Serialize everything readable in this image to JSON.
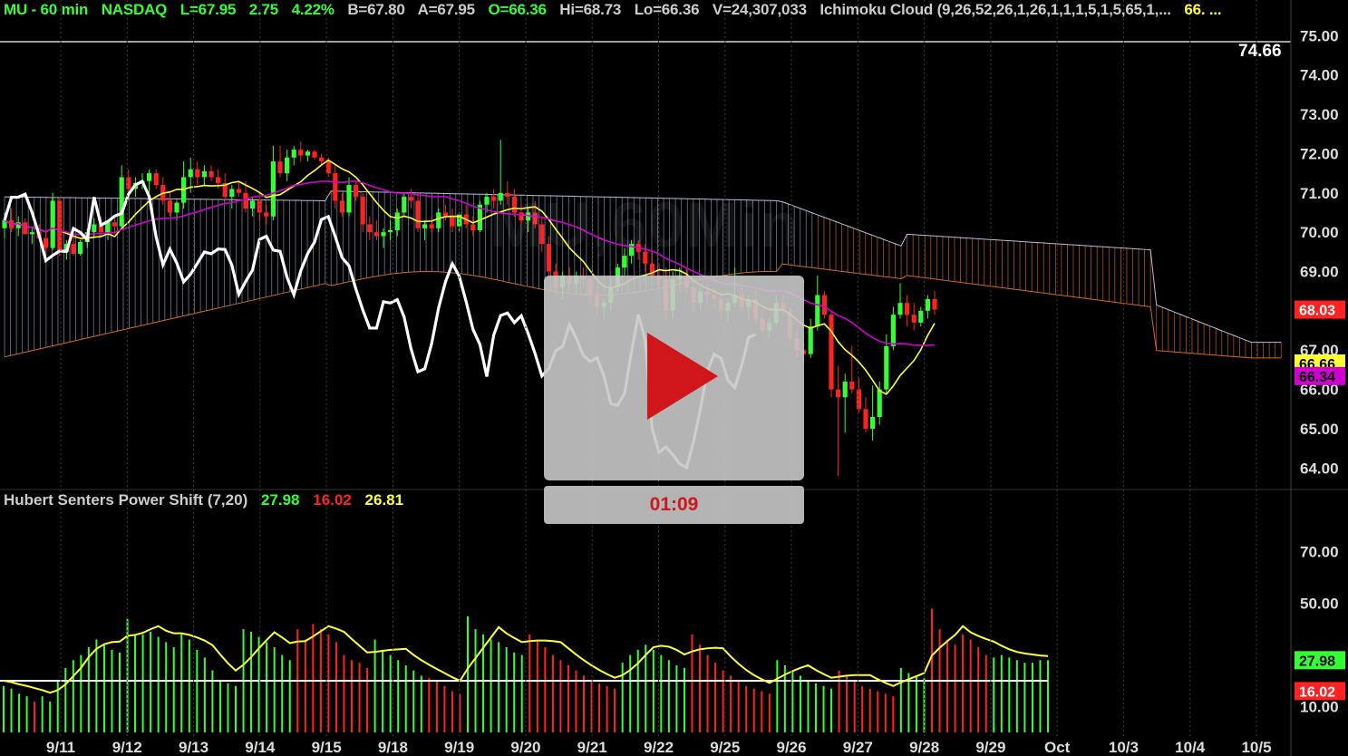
{
  "header": {
    "symbol": "MU - 60 min",
    "exchange": "NASDAQ",
    "last": "L=67.95",
    "change": "2.75",
    "change_pct": "4.22%",
    "bid": "B=67.80",
    "ask": "A=67.95",
    "open": "O=66.36",
    "high": "Hi=68.73",
    "low": "Lo=66.36",
    "volume": "V=24,307,033",
    "study": "Ichimoku Cloud (9,26,52,26,1,26,1,1,1,5,1,5,65,1,...",
    "study_value": "66. ..."
  },
  "watermark": {
    "main": "MU,60Min",
    "sub": "www.hubertsenters"
  },
  "indicator_header": {
    "name": "Hubert Senters Power Shift (7,20)",
    "green": "27.98",
    "red": "16.02",
    "yellow": "26.81"
  },
  "video": {
    "timer": "01:09"
  },
  "colors": {
    "green": "#33ff33",
    "red": "#ff2222",
    "yellow": "#ffff33",
    "magenta": "#d000d0",
    "cloud_up": "#8899bb",
    "cloud_down": "#d2691e",
    "white": "#ffffff"
  },
  "chart_data": {
    "type": "candlestick",
    "price_axis": {
      "ticks": [
        "75.00",
        "74.00",
        "73.00",
        "72.00",
        "71.00",
        "70.00",
        "69.00",
        "68.00",
        "67.00",
        "66.00",
        "65.00",
        "64.00"
      ],
      "ylim": [
        63.5,
        75.4
      ],
      "badges": [
        {
          "label": "74.66",
          "value": 74.66,
          "style": "line"
        },
        {
          "label": "68.03",
          "value": 68.03,
          "style": "red"
        },
        {
          "label": "66.66",
          "value": 66.66,
          "style": "yellow"
        },
        {
          "label": "66.34",
          "value": 66.34,
          "style": "magenta"
        }
      ]
    },
    "indicator_axis": {
      "ticks": [
        "70.00",
        "50.00",
        "10.00"
      ],
      "tick_values": [
        70,
        50,
        10
      ],
      "ylim": [
        0,
        85
      ],
      "badges": [
        {
          "label": "27.98",
          "value": 27.98,
          "style": "green"
        },
        {
          "label": "16.02",
          "value": 16.02,
          "style": "red"
        }
      ]
    },
    "x_labels": [
      "9/11",
      "9/12",
      "9/13",
      "9/14",
      "9/15",
      "9/18",
      "9/19",
      "9/20",
      "9/21",
      "9/22",
      "9/25",
      "9/26",
      "9/27",
      "9/28",
      "9/29",
      "Oct",
      "10/3",
      "10/4",
      "10/5"
    ],
    "candles": [
      [
        70.1,
        70.5,
        69.85,
        70.3
      ],
      [
        70.3,
        70.6,
        70.0,
        70.1
      ],
      [
        70.1,
        70.4,
        69.9,
        70.25
      ],
      [
        70.25,
        70.35,
        69.95,
        69.95
      ],
      [
        69.95,
        70.1,
        69.7,
        70.0
      ],
      [
        70.0,
        70.2,
        69.85,
        69.85
      ],
      [
        69.85,
        70.0,
        69.45,
        69.6
      ],
      [
        69.6,
        71.0,
        69.55,
        70.8
      ],
      [
        70.8,
        70.9,
        69.4,
        69.5
      ],
      [
        69.5,
        69.8,
        69.3,
        69.7
      ],
      [
        69.7,
        69.95,
        69.4,
        69.45
      ],
      [
        69.45,
        69.8,
        69.4,
        69.75
      ],
      [
        69.75,
        70.1,
        69.6,
        70.0
      ],
      [
        70.0,
        70.35,
        69.85,
        70.2
      ],
      [
        70.2,
        70.4,
        69.9,
        70.0
      ],
      [
        70.0,
        70.3,
        69.8,
        70.25
      ],
      [
        70.25,
        70.4,
        69.95,
        70.15
      ],
      [
        70.15,
        71.7,
        70.1,
        71.4
      ],
      [
        71.4,
        71.6,
        70.8,
        71.1
      ],
      [
        71.1,
        71.4,
        70.9,
        71.25
      ],
      [
        71.25,
        71.5,
        71.1,
        71.3
      ],
      [
        71.3,
        71.6,
        71.0,
        71.5
      ],
      [
        71.5,
        71.6,
        71.1,
        71.2
      ],
      [
        71.2,
        71.4,
        70.7,
        70.8
      ],
      [
        70.8,
        71.0,
        70.4,
        70.5
      ],
      [
        70.5,
        70.8,
        70.3,
        70.75
      ],
      [
        70.75,
        71.8,
        70.6,
        71.4
      ],
      [
        71.4,
        71.9,
        71.0,
        71.6
      ],
      [
        71.6,
        71.8,
        71.2,
        71.4
      ],
      [
        71.4,
        71.7,
        71.2,
        71.55
      ],
      [
        71.55,
        71.7,
        71.3,
        71.4
      ],
      [
        71.4,
        71.6,
        71.1,
        71.25
      ],
      [
        71.25,
        71.5,
        70.8,
        70.9
      ],
      [
        70.9,
        71.2,
        70.6,
        71.1
      ],
      [
        71.1,
        71.3,
        70.9,
        71.0
      ],
      [
        71.0,
        71.3,
        70.5,
        70.6
      ],
      [
        70.6,
        70.9,
        70.4,
        70.8
      ],
      [
        70.8,
        71.0,
        70.3,
        70.5
      ],
      [
        70.5,
        70.7,
        70.2,
        70.4
      ],
      [
        70.4,
        72.2,
        70.3,
        71.8
      ],
      [
        71.8,
        72.2,
        71.4,
        71.5
      ],
      [
        71.5,
        72.1,
        71.3,
        71.9
      ],
      [
        71.9,
        72.2,
        71.7,
        72.1
      ],
      [
        72.1,
        72.3,
        71.8,
        71.95
      ],
      [
        71.95,
        72.1,
        71.8,
        72.05
      ],
      [
        72.05,
        72.1,
        71.85,
        71.9
      ],
      [
        71.9,
        72.0,
        71.7,
        71.8
      ],
      [
        71.8,
        71.9,
        71.4,
        71.5
      ],
      [
        71.5,
        71.7,
        70.6,
        70.8
      ],
      [
        70.8,
        71.0,
        70.4,
        70.5
      ],
      [
        70.5,
        71.4,
        70.4,
        71.2
      ],
      [
        71.2,
        71.3,
        70.8,
        70.9
      ],
      [
        70.9,
        71.0,
        70.0,
        70.2
      ],
      [
        70.2,
        70.4,
        69.8,
        70.0
      ],
      [
        70.0,
        70.3,
        69.8,
        69.9
      ],
      [
        69.9,
        70.1,
        69.6,
        70.0
      ],
      [
        70.0,
        70.3,
        69.8,
        70.05
      ],
      [
        70.05,
        70.6,
        69.9,
        70.5
      ],
      [
        70.5,
        71.0,
        70.4,
        70.9
      ],
      [
        70.9,
        71.1,
        70.6,
        70.8
      ],
      [
        70.8,
        71.0,
        70.0,
        70.1
      ],
      [
        70.1,
        70.3,
        69.8,
        70.2
      ],
      [
        70.2,
        70.4,
        70.0,
        70.1
      ],
      [
        70.1,
        70.6,
        70.0,
        70.5
      ],
      [
        70.5,
        70.7,
        70.3,
        70.4
      ],
      [
        70.4,
        70.6,
        70.0,
        70.15
      ],
      [
        70.15,
        70.5,
        70.0,
        70.45
      ],
      [
        70.45,
        70.7,
        70.1,
        70.2
      ],
      [
        70.2,
        70.4,
        69.9,
        70.05
      ],
      [
        70.05,
        70.8,
        70.0,
        70.7
      ],
      [
        70.7,
        71.0,
        70.5,
        70.9
      ],
      [
        70.9,
        71.1,
        70.6,
        70.8
      ],
      [
        70.8,
        72.35,
        70.7,
        71.0
      ],
      [
        71.0,
        71.3,
        70.7,
        70.9
      ],
      [
        70.9,
        71.1,
        70.4,
        70.5
      ],
      [
        70.5,
        70.7,
        70.2,
        70.3
      ],
      [
        70.3,
        70.6,
        70.0,
        70.5
      ],
      [
        70.5,
        70.8,
        70.1,
        70.2
      ],
      [
        70.2,
        70.4,
        69.5,
        69.7
      ],
      [
        69.7,
        69.9,
        68.8,
        69.0
      ],
      [
        69.0,
        69.2,
        68.4,
        68.6
      ],
      [
        68.6,
        69.0,
        68.3,
        68.9
      ],
      [
        68.9,
        69.1,
        68.5,
        68.7
      ],
      [
        68.7,
        69.0,
        68.4,
        68.9
      ],
      [
        68.9,
        69.1,
        68.6,
        68.8
      ],
      [
        68.8,
        68.9,
        68.2,
        68.4
      ],
      [
        68.4,
        68.6,
        67.9,
        68.1
      ],
      [
        68.1,
        68.3,
        67.8,
        68.2
      ],
      [
        68.2,
        68.8,
        68.0,
        68.6
      ],
      [
        68.6,
        69.2,
        68.5,
        69.1
      ],
      [
        69.1,
        69.6,
        68.9,
        69.4
      ],
      [
        69.4,
        69.8,
        69.2,
        69.7
      ],
      [
        69.7,
        69.8,
        69.3,
        69.5
      ],
      [
        69.5,
        69.7,
        69.0,
        69.2
      ],
      [
        69.2,
        69.5,
        68.8,
        68.9
      ],
      [
        68.9,
        69.2,
        68.5,
        68.8
      ],
      [
        68.8,
        69.1,
        67.8,
        68.0
      ],
      [
        68.0,
        69.0,
        67.8,
        68.8
      ],
      [
        68.8,
        69.1,
        68.5,
        68.9
      ],
      [
        68.9,
        69.1,
        68.4,
        68.6
      ],
      [
        68.6,
        68.8,
        68.0,
        68.2
      ],
      [
        68.2,
        68.6,
        68.0,
        68.5
      ],
      [
        68.5,
        68.7,
        68.2,
        68.4
      ],
      [
        68.4,
        68.6,
        68.1,
        68.3
      ],
      [
        68.3,
        68.5,
        67.8,
        68.0
      ],
      [
        68.0,
        68.3,
        67.7,
        68.2
      ],
      [
        68.2,
        69.1,
        68.1,
        68.4
      ],
      [
        68.4,
        68.6,
        68.0,
        68.1
      ],
      [
        68.1,
        68.4,
        67.8,
        68.3
      ],
      [
        68.3,
        68.5,
        67.7,
        67.8
      ],
      [
        67.8,
        68.0,
        67.4,
        67.5
      ],
      [
        67.5,
        67.8,
        67.3,
        67.7
      ],
      [
        67.7,
        68.4,
        67.6,
        68.2
      ],
      [
        68.2,
        68.4,
        67.9,
        68.0
      ],
      [
        68.0,
        68.1,
        67.2,
        67.3
      ],
      [
        67.3,
        67.5,
        66.8,
        67.0
      ],
      [
        67.0,
        67.2,
        66.7,
        66.9
      ],
      [
        66.9,
        67.8,
        66.8,
        67.6
      ],
      [
        67.6,
        68.9,
        67.5,
        68.4
      ],
      [
        68.4,
        68.5,
        67.8,
        67.9
      ],
      [
        67.9,
        68.0,
        65.8,
        66.0
      ],
      [
        66.0,
        66.6,
        63.8,
        65.8
      ],
      [
        65.8,
        66.4,
        64.9,
        66.2
      ],
      [
        66.2,
        67.1,
        65.9,
        66.0
      ],
      [
        66.0,
        66.3,
        65.4,
        65.5
      ],
      [
        65.5,
        65.8,
        64.9,
        65.0
      ],
      [
        65.0,
        66.1,
        64.7,
        65.3
      ],
      [
        65.3,
        66.2,
        65.1,
        66.0
      ],
      [
        66.0,
        67.4,
        65.9,
        67.1
      ],
      [
        67.1,
        68.1,
        67.0,
        67.9
      ],
      [
        67.9,
        68.7,
        67.8,
        68.2
      ],
      [
        68.2,
        68.4,
        67.6,
        67.9
      ],
      [
        67.9,
        68.2,
        67.5,
        67.7
      ],
      [
        67.7,
        68.1,
        67.6,
        68.0
      ],
      [
        68.0,
        68.4,
        67.8,
        68.3
      ],
      [
        68.3,
        68.5,
        67.9,
        68.03
      ]
    ],
    "indicator_bars": [
      [
        18,
        "g"
      ],
      [
        17,
        "g"
      ],
      [
        15,
        "g"
      ],
      [
        14,
        "g"
      ],
      [
        12,
        "r"
      ],
      [
        14,
        "g"
      ],
      [
        12,
        "g"
      ],
      [
        20,
        "g"
      ],
      [
        25,
        "g"
      ],
      [
        28,
        "g"
      ],
      [
        30,
        "g"
      ],
      [
        33,
        "g"
      ],
      [
        36,
        "g"
      ],
      [
        34,
        "g"
      ],
      [
        32,
        "g"
      ],
      [
        31,
        "g"
      ],
      [
        44,
        "g"
      ],
      [
        38,
        "g"
      ],
      [
        38,
        "g"
      ],
      [
        39,
        "g"
      ],
      [
        37,
        "g"
      ],
      [
        35,
        "g"
      ],
      [
        33,
        "g"
      ],
      [
        38,
        "g"
      ],
      [
        36,
        "g"
      ],
      [
        32,
        "g"
      ],
      [
        29,
        "g"
      ],
      [
        24,
        "g"
      ],
      [
        20,
        "g"
      ],
      [
        19,
        "g"
      ],
      [
        18,
        "g"
      ],
      [
        40,
        "g"
      ],
      [
        39,
        "g"
      ],
      [
        37,
        "g"
      ],
      [
        35,
        "g"
      ],
      [
        33,
        "g"
      ],
      [
        30,
        "g"
      ],
      [
        28,
        "g"
      ],
      [
        40,
        "r"
      ],
      [
        36,
        "r"
      ],
      [
        42,
        "r"
      ],
      [
        40,
        "r"
      ],
      [
        38,
        "r"
      ],
      [
        35,
        "r"
      ],
      [
        30,
        "r"
      ],
      [
        28,
        "r"
      ],
      [
        27,
        "r"
      ],
      [
        25,
        "r"
      ],
      [
        36,
        "g"
      ],
      [
        32,
        "g"
      ],
      [
        30,
        "g"
      ],
      [
        28,
        "g"
      ],
      [
        26,
        "g"
      ],
      [
        24,
        "g"
      ],
      [
        22,
        "g"
      ],
      [
        21,
        "r"
      ],
      [
        20,
        "r"
      ],
      [
        18,
        "r"
      ],
      [
        16,
        "r"
      ],
      [
        15,
        "r"
      ],
      [
        45,
        "g"
      ],
      [
        40,
        "g"
      ],
      [
        38,
        "g"
      ],
      [
        36,
        "g"
      ],
      [
        35,
        "g"
      ],
      [
        33,
        "g"
      ],
      [
        31,
        "g"
      ],
      [
        30,
        "g"
      ],
      [
        38,
        "r"
      ],
      [
        36,
        "r"
      ],
      [
        33,
        "r"
      ],
      [
        30,
        "r"
      ],
      [
        28,
        "r"
      ],
      [
        26,
        "r"
      ],
      [
        24,
        "r"
      ],
      [
        22,
        "r"
      ],
      [
        20,
        "r"
      ],
      [
        19,
        "r"
      ],
      [
        18,
        "r"
      ],
      [
        17,
        "r"
      ],
      [
        27,
        "g"
      ],
      [
        30,
        "g"
      ],
      [
        32,
        "g"
      ],
      [
        34,
        "g"
      ],
      [
        32,
        "g"
      ],
      [
        30,
        "g"
      ],
      [
        28,
        "g"
      ],
      [
        26,
        "g"
      ],
      [
        25,
        "g"
      ],
      [
        38,
        "r"
      ],
      [
        34,
        "r"
      ],
      [
        30,
        "r"
      ],
      [
        27,
        "r"
      ],
      [
        24,
        "r"
      ],
      [
        22,
        "r"
      ],
      [
        20,
        "r"
      ],
      [
        18,
        "r"
      ],
      [
        17,
        "r"
      ],
      [
        16,
        "r"
      ],
      [
        15,
        "r"
      ],
      [
        28,
        "g"
      ],
      [
        26,
        "g"
      ],
      [
        24,
        "g"
      ],
      [
        22,
        "g"
      ],
      [
        20,
        "g"
      ],
      [
        19,
        "g"
      ],
      [
        18,
        "g"
      ],
      [
        17,
        "g"
      ],
      [
        24,
        "r"
      ],
      [
        22,
        "r"
      ],
      [
        20,
        "r"
      ],
      [
        18,
        "r"
      ],
      [
        17,
        "r"
      ],
      [
        16,
        "r"
      ],
      [
        15,
        "r"
      ],
      [
        14,
        "r"
      ],
      [
        25,
        "g"
      ],
      [
        23,
        "g"
      ],
      [
        22,
        "g"
      ],
      [
        21,
        "g"
      ],
      [
        48,
        "r"
      ],
      [
        40,
        "r"
      ],
      [
        36,
        "r"
      ],
      [
        34,
        "r"
      ],
      [
        38,
        "r"
      ],
      [
        36,
        "r"
      ],
      [
        33,
        "r"
      ],
      [
        30,
        "r"
      ],
      [
        29,
        "g"
      ],
      [
        30,
        "g"
      ],
      [
        29,
        "g"
      ],
      [
        28,
        "g"
      ],
      [
        27,
        "g"
      ],
      [
        27,
        "g"
      ],
      [
        28,
        "g"
      ],
      [
        27.98,
        "g"
      ]
    ]
  }
}
